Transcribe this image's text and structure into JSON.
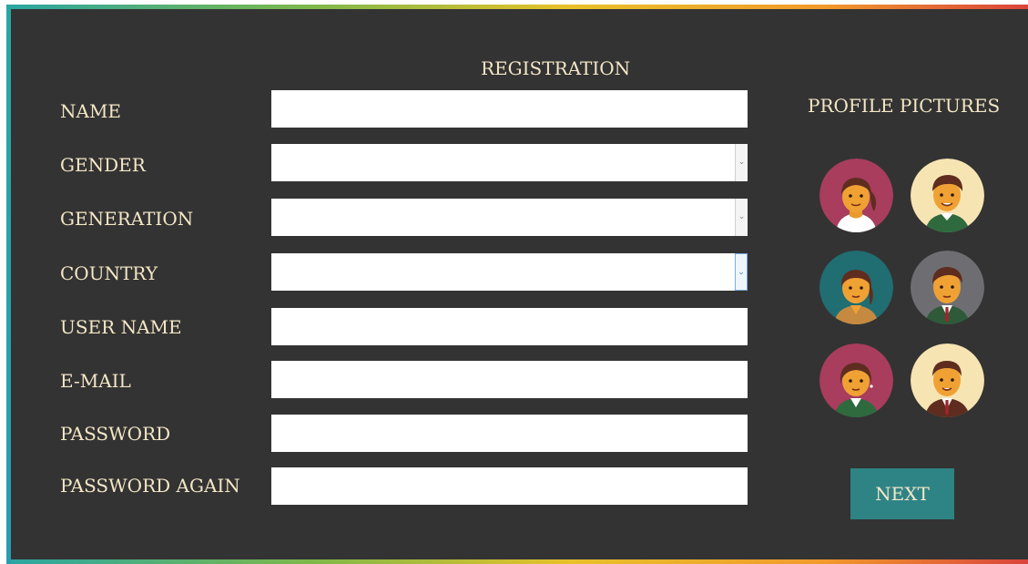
{
  "title": "REGISTRATION",
  "profile_title": "PROFILE PICTURES",
  "fields": {
    "name": {
      "label": "NAME",
      "value": ""
    },
    "gender": {
      "label": "GENDER",
      "value": ""
    },
    "generation": {
      "label": "GENERATION",
      "value": ""
    },
    "country": {
      "label": "COUNTRY",
      "value": ""
    },
    "user_name": {
      "label": "USER NAME",
      "value": ""
    },
    "email": {
      "label": "E-MAIL",
      "value": ""
    },
    "password": {
      "label": "PASSWORD",
      "value": ""
    },
    "password_again": {
      "label": "PASSWORD AGAIN",
      "value": ""
    }
  },
  "dropdown_arrow": "⌄",
  "avatars": [
    {
      "name": "woman-ponytail-avatar",
      "bg": "#a83d5e"
    },
    {
      "name": "man-green-shirt-avatar",
      "bg": "#f7e4b3"
    },
    {
      "name": "woman-teal-avatar",
      "bg": "#206d72"
    },
    {
      "name": "man-suit-grey-avatar",
      "bg": "#6e6e72"
    },
    {
      "name": "woman-blazer-avatar",
      "bg": "#a83d5e"
    },
    {
      "name": "man-suit-cream-avatar",
      "bg": "#f7e4b3"
    }
  ],
  "next_label": "NEXT",
  "colors": {
    "background": "#333333",
    "text": "#f4e7c6",
    "button": "#2e8385"
  }
}
